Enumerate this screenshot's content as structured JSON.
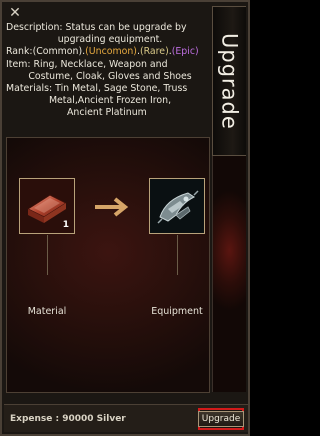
{
  "window": {
    "title": "Upgrade",
    "close_glyph": "✕"
  },
  "description": {
    "line1_label": "Description:",
    "line1_text": "Status can be upgrade by",
    "line2_text": "upgrading equipment.",
    "rank_label": "Rank:",
    "rank_common": "(Common)",
    "sep1": ".",
    "rank_uncommon": "(Uncomon)",
    "sep2": ".",
    "rank_rare": "(Rare)",
    "sep3": ".",
    "rank_epic": "(Epic)",
    "item_label": "Item:",
    "item_line1": "Ring, Necklace, Weapon and",
    "item_line2": "Costume, Cloak, Gloves and Shoes",
    "materials_label": "Materials:",
    "materials_line1": "Tin Metal, Sage Stone, Truss",
    "materials_line2": "Metal,Ancient Frozen Iron,",
    "materials_line3": "Ancient Platinum"
  },
  "slots": {
    "material_label": "Material",
    "material_qty": "1",
    "material_icon": "metal-ingot-icon",
    "equipment_label": "Equipment",
    "equipment_icon": "armor-piece-icon"
  },
  "footer": {
    "expense": "Expense : 90000 Silver",
    "upgrade_button": "Upgrade"
  },
  "colors": {
    "common": "#ebe7db",
    "uncommon": "#e6a940",
    "rare": "#d9c988",
    "epic": "#bd6ee0",
    "highlight": "#d21a1a"
  }
}
